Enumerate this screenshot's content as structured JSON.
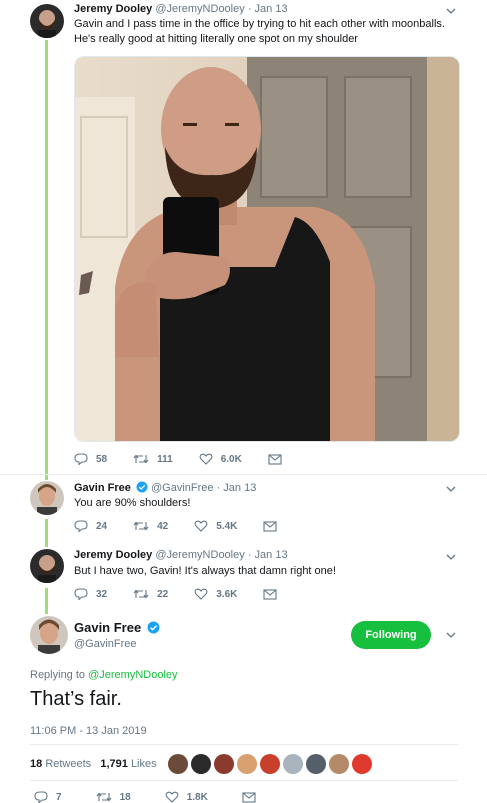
{
  "tweets": [
    {
      "name": "Jeremy Dooley",
      "handle": "@JeremyNDooley",
      "date": "· Jan 13",
      "text_lines": [
        "Gavin and I pass time in the office by trying to hit each other with moonballs.",
        "He's really good at hitting literally one spot on my shoulder"
      ],
      "replies": "58",
      "retweets": "111",
      "likes": "6.0K"
    },
    {
      "name": "Gavin Free",
      "handle": "@GavinFree",
      "date": "· Jan 13",
      "text": "You are 90% shoulders!",
      "replies": "24",
      "retweets": "42",
      "likes": "5.4K"
    },
    {
      "name": "Jeremy Dooley",
      "handle": "@JeremyNDooley",
      "date": "· Jan 13",
      "text": "But I have two, Gavin! It's always that damn right one!",
      "replies": "32",
      "retweets": "22",
      "likes": "3.6K"
    }
  ],
  "main_tweet": {
    "name": "Gavin Free",
    "handle": "@GavinFree",
    "follow_label": "Following",
    "replying_prefix": "Replying to",
    "replying_to": "@JeremyNDooley",
    "text": "That’s fair.",
    "timestamp": "11:06 PM - 13 Jan 2019",
    "retweets_count": "18",
    "retweets_label": "Retweets",
    "likes_count": "1,791",
    "likes_label": "Likes",
    "replies": "7",
    "retweets": "18",
    "likes": "1.8K"
  },
  "colors": {
    "thread_line": "#9cdd7c",
    "follow_button": "#17bf3e",
    "verified": "#1da1f2",
    "link": "#17bf3e"
  }
}
